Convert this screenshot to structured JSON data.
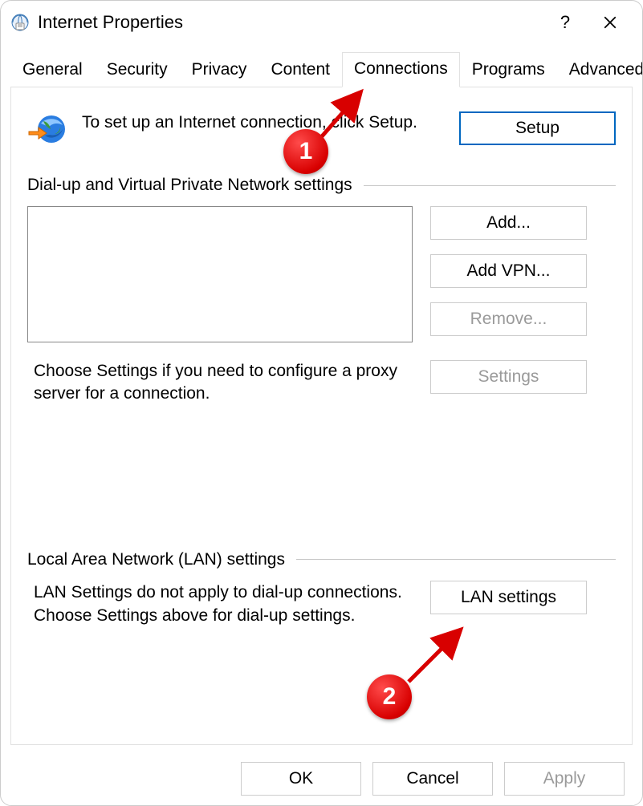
{
  "window": {
    "title": "Internet Properties",
    "help_label": "?",
    "close_label": "Close"
  },
  "tabs": {
    "items": [
      {
        "label": "General",
        "active": false
      },
      {
        "label": "Security",
        "active": false
      },
      {
        "label": "Privacy",
        "active": false
      },
      {
        "label": "Content",
        "active": false
      },
      {
        "label": "Connections",
        "active": true
      },
      {
        "label": "Programs",
        "active": false
      },
      {
        "label": "Advanced",
        "active": false
      }
    ]
  },
  "setup": {
    "text": "To set up an Internet connection, click Setup.",
    "button": "Setup",
    "icon": "globe-arrow-icon"
  },
  "dialup": {
    "heading": "Dial-up and Virtual Private Network settings",
    "buttons": {
      "add": "Add...",
      "add_vpn": "Add VPN...",
      "remove": "Remove...",
      "settings": "Settings"
    },
    "hint": "Choose Settings if you need to configure a proxy server for a connection."
  },
  "lan": {
    "heading": "Local Area Network (LAN) settings",
    "text": "LAN Settings do not apply to dial-up connections. Choose Settings above for dial-up settings.",
    "button": "LAN settings"
  },
  "footer": {
    "ok": "OK",
    "cancel": "Cancel",
    "apply": "Apply"
  },
  "annotations": {
    "callout1": "1",
    "callout2": "2"
  }
}
